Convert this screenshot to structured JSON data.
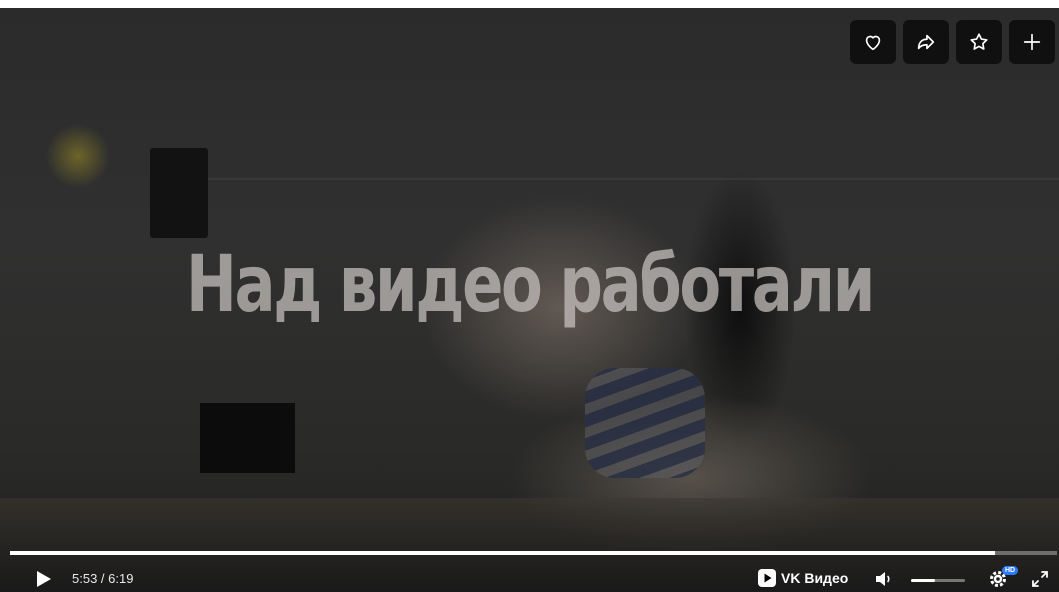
{
  "video": {
    "overlay_text": "Над видео работали"
  },
  "actions": [
    {
      "icon": "heart-icon",
      "name": "like-button"
    },
    {
      "icon": "share-icon",
      "name": "share-button"
    },
    {
      "icon": "star-icon",
      "name": "favorite-button"
    },
    {
      "icon": "plus-icon",
      "name": "add-button"
    }
  ],
  "player": {
    "progress_fraction": 0.941,
    "time_display": "5:53 / 6:19",
    "brand_label": "VK Видео",
    "volume_fraction": 0.45,
    "quality_badge": "HD",
    "colors": {
      "progress": "#ffffff",
      "badge": "#2a7bff",
      "button_bg": "rgba(0,0,0,0.62)"
    }
  }
}
